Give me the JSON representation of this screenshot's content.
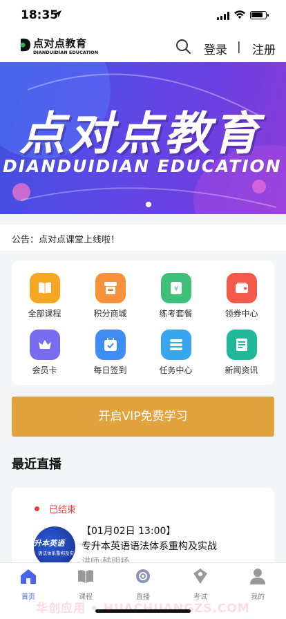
{
  "status_bar": {
    "time": "18:35",
    "location_icon": "location-arrow-icon"
  },
  "header": {
    "logo_cn": "点对点教育",
    "logo_en": "DIANDUIDIAN EDUCATION",
    "search_icon": "search-icon",
    "login": "登录",
    "divider": "|",
    "register": "注册"
  },
  "banner": {
    "title_cn": "点对点教育",
    "title_en": "DIANDUIDIAN  EDUCATION",
    "colors": {
      "from": "#3e4fe0",
      "to": "#8a3cd8"
    }
  },
  "notice": {
    "text": "公告：点对点课堂上线啦！"
  },
  "grid": {
    "items": [
      {
        "label": "全部课程",
        "icon": "book-icon",
        "color": "#f5a623"
      },
      {
        "label": "积分商城",
        "icon": "shop-icon",
        "color": "#f7923a"
      },
      {
        "label": "练考套餐",
        "icon": "package-icon",
        "color": "#3ec07a"
      },
      {
        "label": "领券中心",
        "icon": "coupon-icon",
        "color": "#f2594b"
      },
      {
        "label": "会员卡",
        "icon": "crown-icon",
        "color": "#7a6cf0"
      },
      {
        "label": "每日签到",
        "icon": "calendar-check-icon",
        "color": "#3f8df2"
      },
      {
        "label": "任务中心",
        "icon": "task-list-icon",
        "color": "#3aa6f0"
      },
      {
        "label": "新闻资讯",
        "icon": "news-icon",
        "color": "#22b89a"
      }
    ]
  },
  "vip_button": {
    "label": "开启VIP免费学习",
    "color": "#e2a23e"
  },
  "live": {
    "section_title": "最近直播",
    "status": "已结束",
    "thumb_title": "升本英语",
    "thumb_subtitle": "语法体系重构及实战",
    "time": "【01月02日 13:00】",
    "name": "专升本英语语法体系重构及实战",
    "teacher": "讲师:韩明扬"
  },
  "tabbar": {
    "tabs": [
      {
        "label": "首页",
        "icon": "home-icon",
        "active": true
      },
      {
        "label": "课程",
        "icon": "book-open-icon",
        "active": false
      },
      {
        "label": "直播",
        "icon": "live-icon",
        "active": false
      },
      {
        "label": "考试",
        "icon": "exam-icon",
        "active": false
      },
      {
        "label": "我的",
        "icon": "profile-icon",
        "active": false
      }
    ],
    "active_color": "#4a64e8"
  },
  "watermark": "华创应用 • HUACHUANGZS.COM"
}
